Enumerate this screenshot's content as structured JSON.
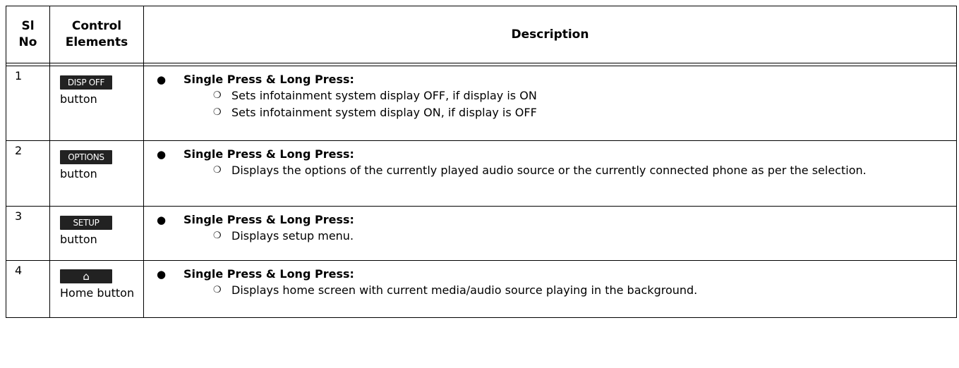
{
  "headers": {
    "sl_no": "Sl No",
    "control": "Control Elements",
    "description": "Description"
  },
  "rows": [
    {
      "no": "1",
      "button_text": "DISP OFF",
      "label": "button",
      "bullet_title": "Single Press & Long Press:",
      "subs": [
        "Sets infotainment system display OFF, if display is ON",
        "Sets infotainment system display ON, if display is OFF"
      ]
    },
    {
      "no": "2",
      "button_text": "OPTIONS",
      "label": "button",
      "bullet_title": "Single Press & Long Press:",
      "subs": [
        "Displays the options of the currently played audio source or the currently connected phone as per the selection."
      ]
    },
    {
      "no": "3",
      "button_text": "SETUP",
      "label": "button",
      "bullet_title": "Single Press & Long Press:",
      "subs": [
        "Displays setup menu."
      ]
    },
    {
      "no": "4",
      "button_text": "",
      "button_icon": "home-icon",
      "label": "Home button",
      "bullet_title": "Single Press & Long Press:",
      "subs": [
        "Displays home screen with current media/audio source playing in the background."
      ]
    }
  ],
  "glyphs": {
    "bullet": "●",
    "sub_bullet": "❍",
    "home": "⌂"
  }
}
